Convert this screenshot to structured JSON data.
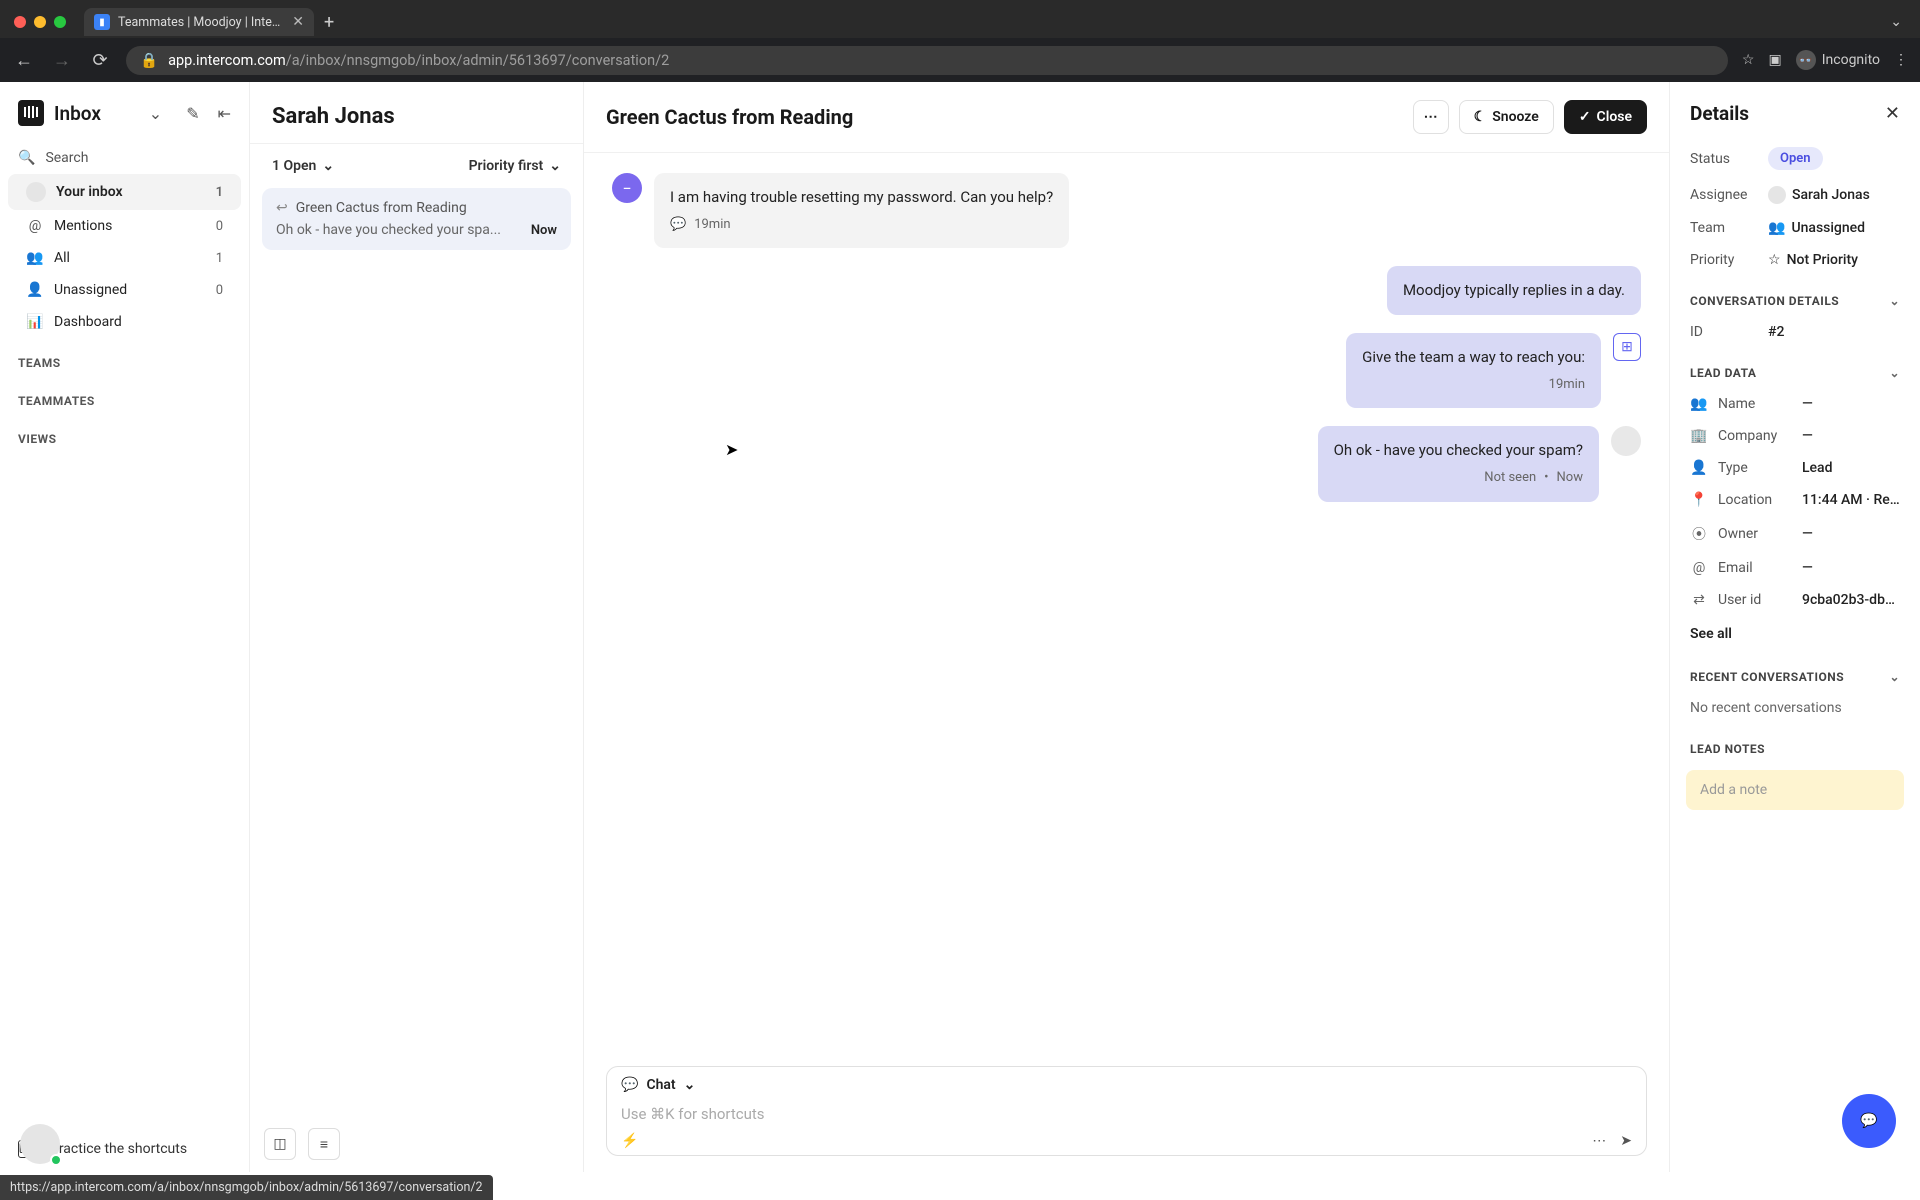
{
  "browser": {
    "tab_title": "Teammates | Moodjoy | Interco",
    "url_host": "app.intercom.com",
    "url_path": "/a/inbox/nnsgmgob/inbox/admin/5613697/conversation/2",
    "incognito_label": "Incognito",
    "status_url": "https://app.intercom.com/a/inbox/nnsgmgob/inbox/admin/5613697/conversation/2"
  },
  "sidebar": {
    "title": "Inbox",
    "search_label": "Search",
    "items": [
      {
        "label": "Your inbox",
        "count": "1",
        "icon": "avatar"
      },
      {
        "label": "Mentions",
        "count": "0",
        "icon": "@"
      },
      {
        "label": "All",
        "count": "1",
        "icon": "👥"
      },
      {
        "label": "Unassigned",
        "count": "0",
        "icon": "👤"
      },
      {
        "label": "Dashboard",
        "count": "",
        "icon": "📊"
      }
    ],
    "sections": [
      "TEAMS",
      "TEAMMATES",
      "VIEWS"
    ],
    "shortcut_label": "Practice the shortcuts"
  },
  "inbox": {
    "owner": "Sarah Jonas",
    "filter": "1 Open",
    "sort": "Priority first",
    "conversation": {
      "name": "Green Cactus from Reading",
      "preview": "Oh ok - have you checked your spa...",
      "time": "Now"
    }
  },
  "chat": {
    "title": "Green Cactus from Reading",
    "snooze": "Snooze",
    "close": "Close",
    "messages": {
      "m0": {
        "text": "I am having trouble resetting my password. Can you help?",
        "meta": "19min"
      },
      "m1": {
        "text": "Moodjoy typically replies in a day."
      },
      "m2": {
        "text": "Give the team a way to reach you:",
        "meta": "19min"
      },
      "m3": {
        "text": "Oh ok - have you checked your spam?",
        "meta_status": "Not seen",
        "meta_time": "Now"
      }
    },
    "composer": {
      "mode": "Chat",
      "placeholder": "Use ⌘K for shortcuts"
    }
  },
  "details": {
    "title": "Details",
    "status_label": "Status",
    "status_value": "Open",
    "assignee_label": "Assignee",
    "assignee_value": "Sarah Jonas",
    "team_label": "Team",
    "team_value": "Unassigned",
    "priority_label": "Priority",
    "priority_value": "Not Priority",
    "conv_section": "CONVERSATION DETAILS",
    "id_label": "ID",
    "id_value": "#2",
    "lead_section": "LEAD DATA",
    "lead": [
      {
        "icon": "👥",
        "label": "Name",
        "value": "—"
      },
      {
        "icon": "🏢",
        "label": "Company",
        "value": "—"
      },
      {
        "icon": "👤",
        "label": "Type",
        "value": "Lead"
      },
      {
        "icon": "📍",
        "label": "Location",
        "value": "11:44 AM · Rea..."
      },
      {
        "icon": "⦿",
        "label": "Owner",
        "value": "—"
      },
      {
        "icon": "@",
        "label": "Email",
        "value": "—"
      },
      {
        "icon": "⇄",
        "label": "User id",
        "value": "9cba02b3-dbd..."
      }
    ],
    "see_all": "See all",
    "recent_section": "RECENT CONVERSATIONS",
    "recent_empty": "No recent conversations",
    "notes_section": "LEAD NOTES",
    "notes_placeholder": "Add a note"
  }
}
